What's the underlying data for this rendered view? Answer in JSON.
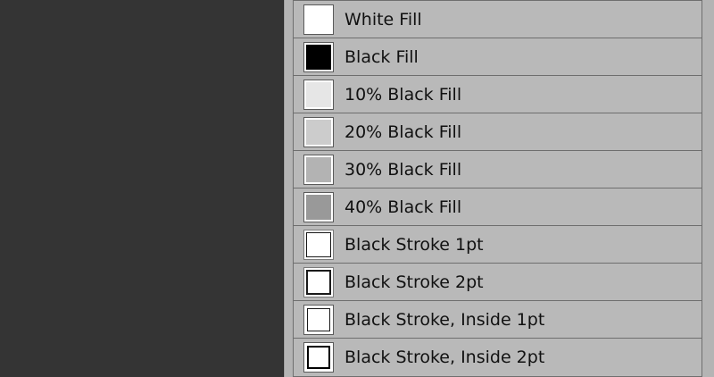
{
  "styles_list": {
    "items": [
      {
        "label": "White Fill",
        "swatch": "fill",
        "color": "#ffffff"
      },
      {
        "label": "Black Fill",
        "swatch": "fill",
        "color": "#000000"
      },
      {
        "label": "10% Black Fill",
        "swatch": "fill",
        "color": "#e6e6e6"
      },
      {
        "label": "20% Black Fill",
        "swatch": "fill",
        "color": "#cccccc"
      },
      {
        "label": "30% Black Fill",
        "swatch": "fill",
        "color": "#b3b3b3"
      },
      {
        "label": "40% Black Fill",
        "swatch": "fill",
        "color": "#999999"
      },
      {
        "label": "Black Stroke 1pt",
        "swatch": "stroke",
        "stroke_pt": 1,
        "inside": false
      },
      {
        "label": "Black Stroke 2pt",
        "swatch": "stroke",
        "stroke_pt": 2,
        "inside": false
      },
      {
        "label": "Black Stroke, Inside 1pt",
        "swatch": "stroke",
        "stroke_pt": 1,
        "inside": true
      },
      {
        "label": "Black Stroke, Inside 2pt",
        "swatch": "stroke",
        "stroke_pt": 2,
        "inside": true
      }
    ]
  },
  "colors": {
    "workspace_bg": "#343434",
    "panel_bg": "#b4b4b4",
    "row_bg": "#b9b9b9",
    "row_border": "#6e6e6e"
  }
}
